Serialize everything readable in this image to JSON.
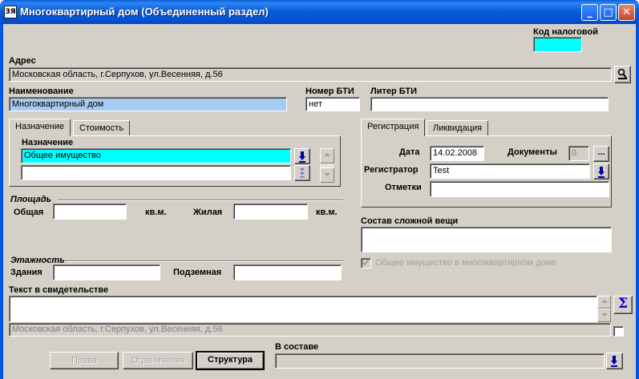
{
  "window": {
    "title": "Многоквартирный дом (Объединенный раздел)",
    "app_icon_text": "ЗЯ",
    "minimize_glyph": "_",
    "maximize_glyph": "□",
    "close_glyph": "✕"
  },
  "tax_code": {
    "label": "Код налоговой",
    "value": ""
  },
  "address": {
    "label": "Адрес",
    "value": "Московская область, г.Серпухов, ул.Весенняя, д.56",
    "lookup_icon": "magnifier-icon"
  },
  "name": {
    "label": "Наименование",
    "value": "Многоквартирный дом"
  },
  "bti_number": {
    "label": "Номер БТИ",
    "value": "нет"
  },
  "bti_letter": {
    "label": "Литер БТИ",
    "value": ""
  },
  "left_tabs": {
    "tabs": [
      {
        "label": "Назначение",
        "active": true
      },
      {
        "label": "Стоимость",
        "active": false
      }
    ],
    "purpose_label": "Назначение",
    "purpose_value": "Общее имущество",
    "purpose_value_2": ""
  },
  "area": {
    "group_label": "Площадь",
    "total_label": "Общая",
    "total_value": "",
    "total_unit": "кв.м.",
    "living_label": "Жилая",
    "living_value": "",
    "living_unit": "кв.м."
  },
  "floors": {
    "group_label": "Этажность",
    "building_label": "Здания",
    "building_value": "",
    "underground_label": "Подземная",
    "underground_value": ""
  },
  "right_tabs": {
    "tabs": [
      {
        "label": "Регистрация",
        "active": true
      },
      {
        "label": "Ликвидация",
        "active": false
      }
    ],
    "date_label": "Дата",
    "date_value": "14.02.2008",
    "documents_label": "Документы",
    "documents_count": "0",
    "documents_button": "...",
    "registrar_label": "Регистратор",
    "registrar_value": "Test",
    "notes_label": "Отметки",
    "notes_value": ""
  },
  "complex_thing": {
    "label": "Состав сложной вещи",
    "value": ""
  },
  "common_property_checkbox": {
    "label": "Общее имущество в многоквартирном доме",
    "checked": true,
    "enabled": false
  },
  "certificate_text": {
    "label": "Текст в свидетельстве",
    "value": "",
    "address_line": "Московская область, г.Серпухов, ул.Весенняя, д.56",
    "sum_glyph": "Σ",
    "checked": false
  },
  "buttons": {
    "rights": "Права",
    "restrictions": "Ограничения",
    "structure": "Структура"
  },
  "in_composition": {
    "label": "В составе",
    "value": ""
  }
}
